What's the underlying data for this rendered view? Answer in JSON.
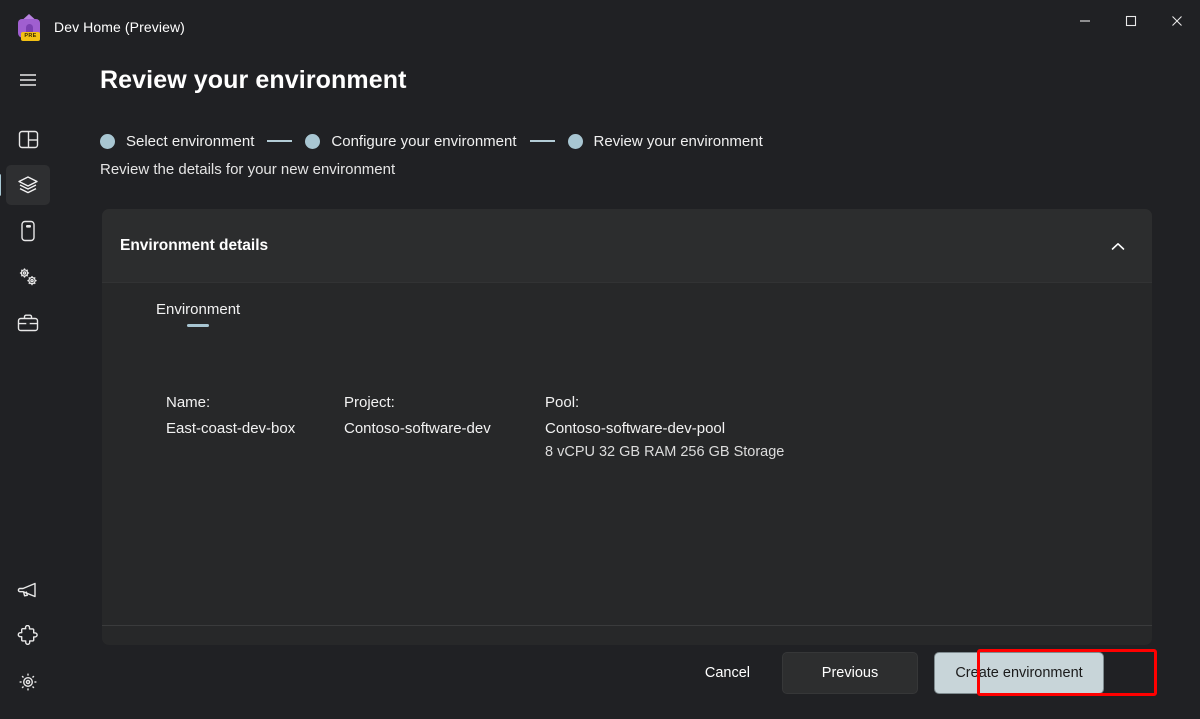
{
  "window": {
    "title": "Dev Home (Preview)",
    "app_icon": "dev-home-icon",
    "badge_text": "PRE",
    "controls": {
      "minimize": "minimize-icon",
      "maximize": "maximize-icon",
      "close": "close-icon"
    }
  },
  "sidebar": {
    "top_items": [
      {
        "icon": "hamburger-menu-icon",
        "name": "menu"
      },
      {
        "icon": "dashboard-icon",
        "name": "dashboard"
      },
      {
        "icon": "layers-icon",
        "name": "environments",
        "selected": true
      },
      {
        "icon": "machine-configuration-icon",
        "name": "machine-configuration"
      },
      {
        "icon": "gears-icon",
        "name": "utilities"
      },
      {
        "icon": "briefcase-icon",
        "name": "workspaces"
      }
    ],
    "bottom_items": [
      {
        "icon": "megaphone-icon",
        "name": "feedback"
      },
      {
        "icon": "puzzle-piece-icon",
        "name": "extensions"
      },
      {
        "icon": "gear-icon",
        "name": "settings"
      }
    ]
  },
  "page": {
    "title": "Review your environment",
    "subtitle": "Review the details for your new environment",
    "steps": [
      {
        "label": "Select environment"
      },
      {
        "label": "Configure your environment"
      },
      {
        "label": "Review your environment"
      }
    ]
  },
  "card": {
    "header_title": "Environment details",
    "collapse_icon": "chevron-up-icon",
    "tabs": [
      {
        "label": "Environment",
        "active": true
      }
    ],
    "fields": [
      {
        "label": "Name:",
        "value": "East-coast-dev-box",
        "sub": ""
      },
      {
        "label": "Project:",
        "value": "Contoso-software-dev",
        "sub": ""
      },
      {
        "label": "Pool:",
        "value": "Contoso-software-dev-pool",
        "sub": "8 vCPU 32 GB RAM 256 GB Storage"
      }
    ]
  },
  "footer": {
    "cancel_label": "Cancel",
    "previous_label": "Previous",
    "create_label": "Create environment"
  },
  "colors": {
    "background": "#202124",
    "card": "#272829",
    "card_header": "#2c2d2e",
    "accent": "#a8c6d2",
    "accent_button": "#c8d5d9",
    "highlight": "#ff0000",
    "badge": "#f2c014"
  }
}
